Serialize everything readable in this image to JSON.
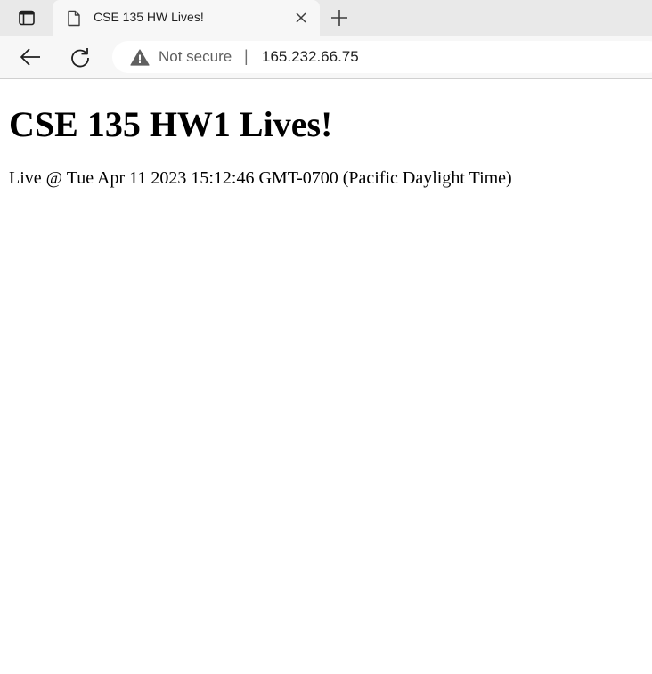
{
  "browser": {
    "tab": {
      "title": "CSE 135 HW Lives!"
    },
    "address_bar": {
      "security_label": "Not secure",
      "url": "165.232.66.75"
    }
  },
  "page": {
    "heading": "CSE 135 HW1 Lives!",
    "live_text": "Live @ Tue Apr 11 2023 15:12:46 GMT-0700 (Pacific Daylight Time)"
  },
  "icons": {
    "tab_actions": "tab-actions-icon",
    "page": "page-icon",
    "close": "close-icon",
    "new_tab": "plus-icon",
    "back": "back-arrow-icon",
    "reload": "reload-icon",
    "warning": "warning-triangle-icon"
  }
}
